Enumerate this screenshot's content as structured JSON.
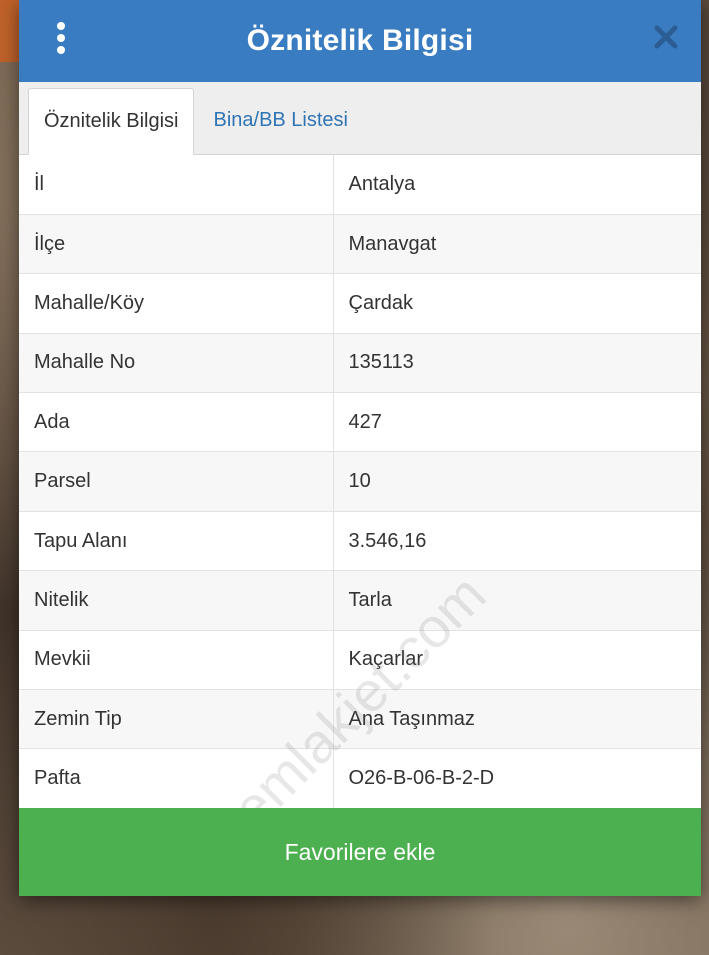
{
  "header": {
    "title": "Öznitelik Bilgisi",
    "menu_icon": "vertical-dots-icon",
    "close_icon": "close-icon"
  },
  "tabs": [
    {
      "label": "Öznitelik Bilgisi",
      "active": true
    },
    {
      "label": "Bina/BB Listesi",
      "active": false
    }
  ],
  "rows": [
    {
      "key": "İl",
      "value": "Antalya"
    },
    {
      "key": "İlçe",
      "value": "Manavgat"
    },
    {
      "key": "Mahalle/Köy",
      "value": "Çardak"
    },
    {
      "key": "Mahalle No",
      "value": "135113"
    },
    {
      "key": "Ada",
      "value": "427"
    },
    {
      "key": "Parsel",
      "value": "10"
    },
    {
      "key": "Tapu Alanı",
      "value": "3.546,16"
    },
    {
      "key": "Nitelik",
      "value": "Tarla"
    },
    {
      "key": "Mevkii",
      "value": "Kaçarlar"
    },
    {
      "key": "Zemin Tip",
      "value": "Ana Taşınmaz"
    },
    {
      "key": "Pafta",
      "value": "O26-B-06-B-2-D"
    }
  ],
  "watermark": "emlakjet.com",
  "footer": {
    "button_label": "Favorilere ekle"
  },
  "colors": {
    "header_bg": "#3a7cc2",
    "button_bg": "#4caf50",
    "tab_link": "#2f74b5"
  }
}
